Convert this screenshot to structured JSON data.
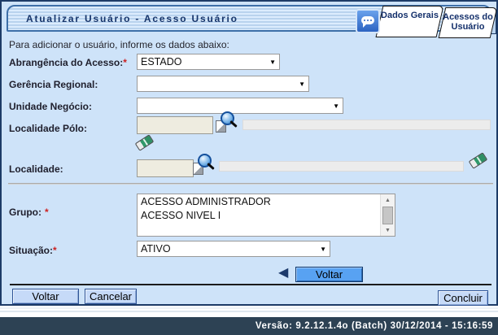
{
  "header": {
    "title": "Atualizar Usuário - Acesso Usuário",
    "tabs": [
      {
        "label": "Dados Gerais",
        "active": true
      },
      {
        "label": "Acessos do Usuário",
        "active": false
      }
    ]
  },
  "intro_text": "Para adicionar o usuário, informe os dados abaixo:",
  "form": {
    "abrangencia_acesso": {
      "label": "Abrangência do Acesso:",
      "required_marker": "*",
      "value": "ESTADO"
    },
    "gerencia_regional": {
      "label": "Gerência Regional:",
      "value": ""
    },
    "unidade_negocio": {
      "label": "Unidade Negócio:",
      "value": ""
    },
    "localidade_polo": {
      "label": "Localidade Pólo:",
      "value": "",
      "display_value": ""
    },
    "localidade": {
      "label": "Localidade:",
      "value": "",
      "display_value": ""
    },
    "grupo": {
      "label": "Grupo:",
      "required_marker": "*",
      "options": [
        "ACESSO ADMINISTRADOR",
        "ACESSO NIVEL I"
      ]
    },
    "situacao": {
      "label": "Situação:",
      "required_marker": "*",
      "value": "ATIVO"
    }
  },
  "buttons": {
    "voltar_inline": "Voltar",
    "voltar": "Voltar",
    "cancelar": "Cancelar",
    "concluir": "Concluir"
  },
  "icons": {
    "dropdown_glyph": "▼",
    "scroll_up_glyph": "▲",
    "scroll_down_glyph": "▼",
    "back_glyph": "◀"
  },
  "footer": {
    "version_text": "Versão: 9.2.12.1.4o (Batch) 30/12/2014 - 15:16:59"
  },
  "colors": {
    "page_bg": "#cee3f9",
    "container_border": "#1d3b67",
    "header_border": "#3d6fa8",
    "accent_button_blue": "#58a2f2",
    "light_button_blue": "#c6daf8",
    "footer_bg": "#2d4254",
    "required_red": "#cc2222"
  }
}
